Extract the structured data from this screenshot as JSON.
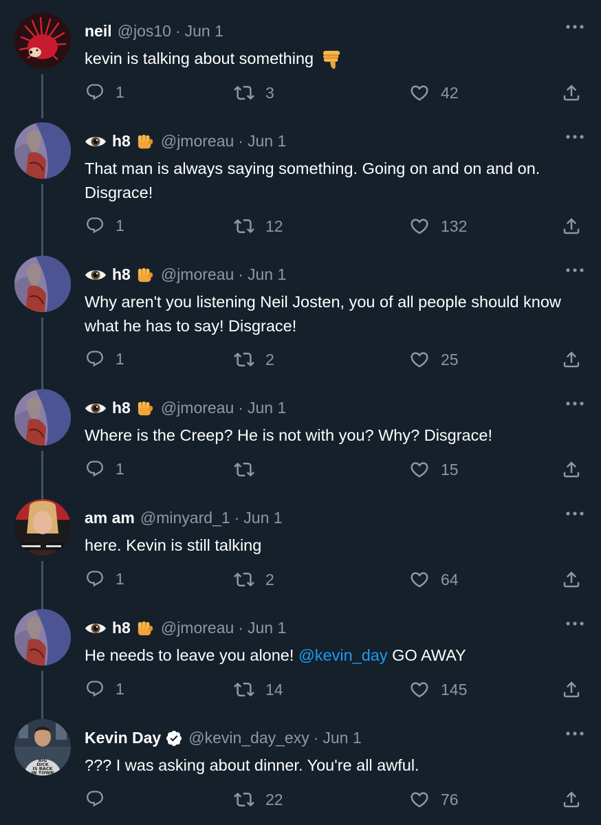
{
  "tweets": [
    {
      "avatar": "red-hedgehog-avatar",
      "display_prefix_eye": false,
      "name": "neil",
      "handle": "@jos10",
      "dot": "·",
      "date": "Jun 1",
      "text": "kevin is talking about something ",
      "emoji_after": "thumbs-down-icon",
      "reply_count": "1",
      "retweet_count": "3",
      "like_count": "42"
    },
    {
      "avatar": "cartoon-avatar",
      "display_prefix_eye": true,
      "name": "h8",
      "handle": "@jmoreau",
      "dot": "·",
      "date": "Jun 1",
      "text": "That man is always saying something. Going on and on and on. Disgrace!",
      "reply_count": "1",
      "retweet_count": "12",
      "like_count": "132"
    },
    {
      "avatar": "cartoon-avatar",
      "display_prefix_eye": true,
      "name": "h8",
      "handle": "@jmoreau",
      "dot": "·",
      "date": "Jun 1",
      "text": "Why aren't you listening Neil Josten, you of all people should know what he has to say! Disgrace!",
      "reply_count": "1",
      "retweet_count": "2",
      "like_count": "25"
    },
    {
      "avatar": "cartoon-avatar",
      "display_prefix_eye": true,
      "name": "h8",
      "handle": "@jmoreau",
      "dot": "·",
      "date": "Jun 1",
      "text": "Where is the Creep? He is not with you? Why? Disgrace!",
      "reply_count": "1",
      "retweet_count": "",
      "like_count": "15"
    },
    {
      "avatar": "woman-photo-avatar",
      "display_prefix_eye": false,
      "name": "am am",
      "handle": "@minyard_1",
      "dot": "·",
      "date": "Jun 1",
      "text": "here. Kevin is still talking",
      "reply_count": "1",
      "retweet_count": "2",
      "like_count": "64"
    },
    {
      "avatar": "cartoon-avatar",
      "display_prefix_eye": true,
      "name": "h8",
      "handle": "@jmoreau",
      "dot": "·",
      "date": "Jun 1",
      "text_before": "He needs to leave you alone! ",
      "mention": "@kevin_day",
      "text_after": " GO AWAY",
      "reply_count": "1",
      "retweet_count": "14",
      "like_count": "145"
    },
    {
      "avatar": "man-photo-avatar",
      "display_prefix_eye": false,
      "verified": true,
      "name": "Kevin Day",
      "handle": "@kevin_day_exy",
      "dot": "·",
      "date": "Jun 1",
      "text": "??? I was asking about dinner. You're all awful.",
      "reply_count": "",
      "retweet_count": "22",
      "like_count": "76"
    }
  ],
  "avatar_shirt_text": "BIG DICK IS BACK IN TOWN",
  "colors": {
    "background": "#15202b",
    "muted": "#8b98a5",
    "link": "#1d9bf0",
    "thread_line": "#425364"
  }
}
